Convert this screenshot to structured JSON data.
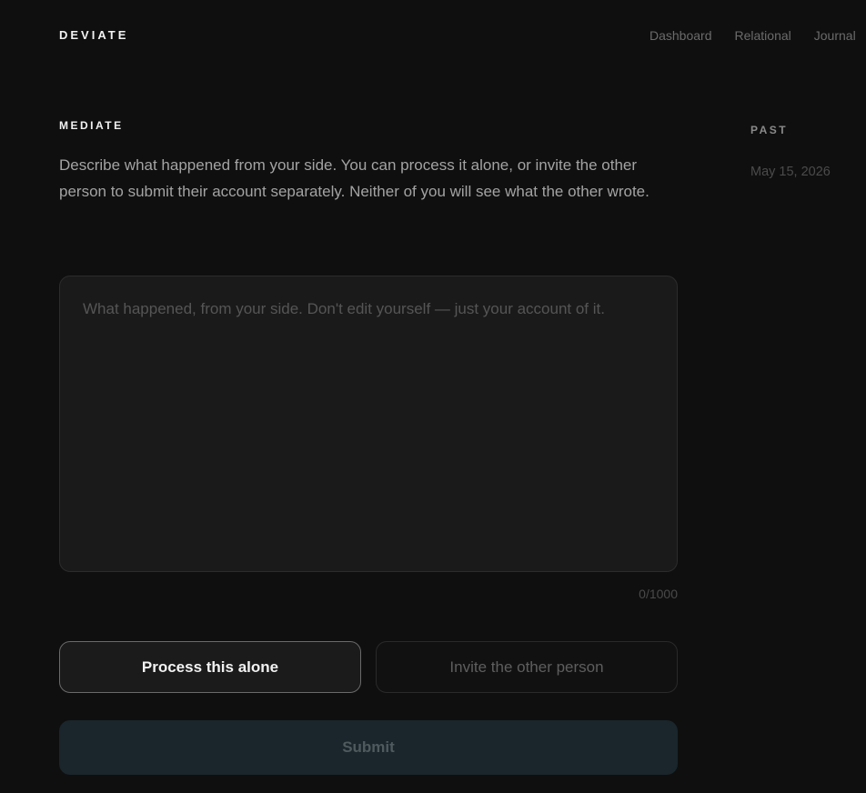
{
  "header": {
    "brand": "DEVIATE",
    "nav": [
      "Dashboard",
      "Relational",
      "Journal"
    ]
  },
  "mediate": {
    "label": "MEDIATE",
    "intro": "Describe what happened from your side. You can process it alone, or invite the other person to submit their account separately. Neither of you will see what the other wrote.",
    "account": {
      "value": "",
      "placeholder": "What happened, from your side. Don't edit yourself — just your account of it.",
      "counter": "0/1000"
    },
    "modes": {
      "alone": "Process this alone",
      "invite": "Invite the other person",
      "selected": "alone"
    },
    "submit": "Submit"
  },
  "past": {
    "label": "PAST",
    "items": [
      "May 15, 2026"
    ]
  },
  "colors": {
    "background": "#0f0f0f",
    "panel": "#1a1a1a",
    "submit_bg": "#1a262c",
    "text_primary": "#f2f2f2",
    "text_muted": "#a3a3a3"
  }
}
